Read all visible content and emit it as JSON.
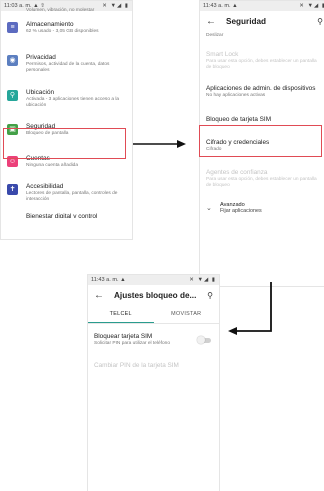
{
  "screen1": {
    "status": {
      "time": "11:03 a. m.",
      "icons_left": "▲ ⇧",
      "icons_right": "✕ ▼◢ ▮"
    },
    "top_cut_text": "Volumen, vibración, no molestar",
    "items": [
      {
        "title": "Almacenamiento",
        "subtitle": "62 % usado - 3,05 GB disponibles",
        "icon": "storage-icon",
        "color": "#5c6bc0",
        "glyph": "≡"
      },
      {
        "title": "Privacidad",
        "subtitle": "Permisos, actividad de la cuenta, datos personales",
        "icon": "privacy-icon",
        "color": "#5c7fc0",
        "glyph": "◉"
      },
      {
        "title": "Ubicación",
        "subtitle": "Activada - 3 aplicaciones tienen acceso a la ubicación",
        "icon": "location-icon",
        "color": "#26a69a",
        "glyph": "⚲"
      },
      {
        "title": "Seguridad",
        "subtitle": "Bloqueo de pantalla",
        "icon": "security-lock-icon",
        "color": "#43a047",
        "glyph": "🔒"
      },
      {
        "title": "Cuentas",
        "subtitle": "Ninguna cuenta añadida",
        "icon": "accounts-icon",
        "color": "#ec407a",
        "glyph": "☺"
      },
      {
        "title": "Accesibilidad",
        "subtitle": "Lectores de pantalla, pantalla, controles de interacción",
        "icon": "accessibility-icon",
        "color": "#3949ab",
        "glyph": "✝"
      }
    ],
    "bottom_cut_text": "Bienestar digital y control"
  },
  "screen2": {
    "status": {
      "time": "11:43 a. m.",
      "icons_left": "▲",
      "icons_right": "✕ ▼◢ ▮"
    },
    "title": "Seguridad",
    "top_cut_text": "Deslizar",
    "rows": [
      {
        "title": "Smart Lock",
        "subtitle": "Para usar esta opción, debes establecer un pantalla de bloqueo",
        "dim": true
      },
      {
        "title": "Aplicaciones de admin. de dispositivos",
        "subtitle": "No hay aplicaciones activas",
        "dim": false
      },
      {
        "title": "Bloqueo de tarjeta SIM",
        "subtitle": "",
        "dim": false
      },
      {
        "title": "Cifrado y credenciales",
        "subtitle": "Cifrado",
        "dim": false
      },
      {
        "title": "Agentes de confianza",
        "subtitle": "Para usar esta opción, debes establecer un pantalla de bloqueo",
        "dim": true
      }
    ],
    "advanced": {
      "title": "Avanzado",
      "subtitle": "Fijar aplicaciones"
    }
  },
  "screen3": {
    "status": {
      "time": "11:43 a. m.",
      "icons_left": "▲",
      "icons_right": "✕ ▼◢ ▮"
    },
    "title": "Ajustes bloqueo de...",
    "tabs": [
      "TELCEL",
      "MOVISTAR"
    ],
    "lock_sim": {
      "title": "Bloquear tarjeta SIM",
      "subtitle": "Solicitar PIN para utilizar el teléfono",
      "enabled": false
    },
    "change_pin": "Cambiar PIN de la tarjeta SIM"
  },
  "colors": {
    "highlight": "#e04b55",
    "tab_indicator": "#2a9c8e",
    "arrow": "#111111"
  }
}
